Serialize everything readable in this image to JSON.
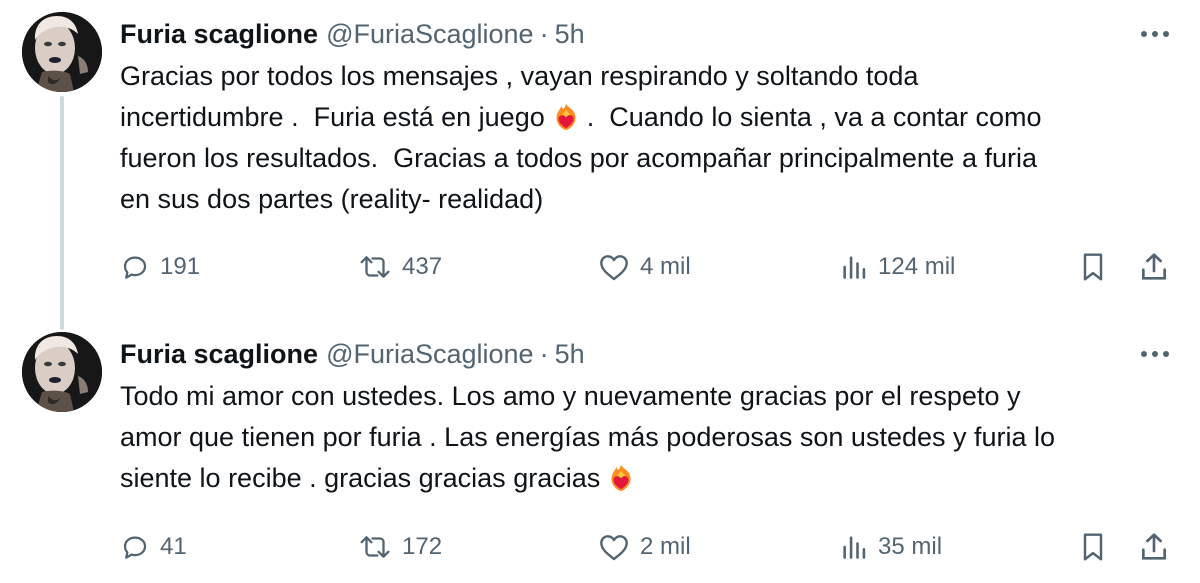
{
  "thread": {
    "tweets": [
      {
        "author_name": "Furia scaglione",
        "handle": "@FuriaScaglione",
        "separator": "·",
        "time": "5h",
        "lines": [
          "Gracias por todos los mensajes , vayan respirando y soltando toda",
          "incertidumbre .  Furia está en juego",
          ".  Cuando lo sienta , va a contar como",
          "fueron los resultados.  Gracias a todos por acompañar principalmente a furia",
          "en sus dos partes (reality- realidad)"
        ],
        "emoji": "heart-on-fire-emoji",
        "replies": "191",
        "retweets": "437",
        "likes": "4 mil",
        "views": "124 mil"
      },
      {
        "author_name": "Furia scaglione",
        "handle": "@FuriaScaglione",
        "separator": "·",
        "time": "5h",
        "lines": [
          "Todo mi amor con ustedes. Los amo y nuevamente gracias por el respeto y",
          "amor que tienen por furia . Las energías más poderosas son ustedes y furia lo",
          "siente lo recibe . gracias gracias gracias"
        ],
        "emoji": "heart-on-fire-emoji",
        "replies": "41",
        "retweets": "172",
        "likes": "2 mil",
        "views": "35 mil"
      }
    ]
  },
  "colors": {
    "text_primary": "#0f1419",
    "text_secondary": "#536471",
    "thread_line": "#cfd9de",
    "background": "#ffffff"
  },
  "icons": [
    "avatar",
    "more-icon",
    "reply-icon",
    "retweet-icon",
    "like-icon",
    "views-icon",
    "bookmark-icon",
    "share-icon",
    "heart-on-fire-emoji"
  ]
}
